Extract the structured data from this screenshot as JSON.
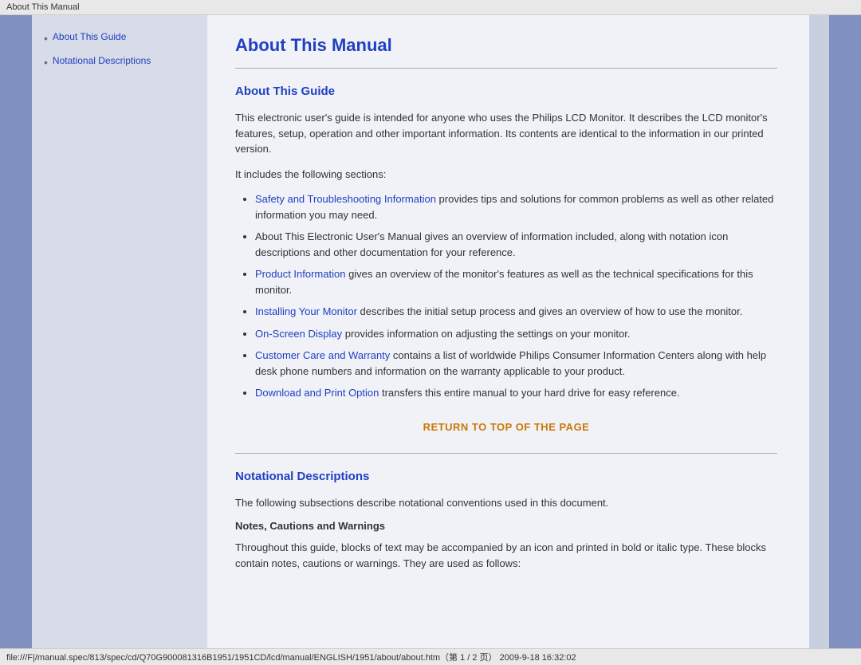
{
  "titleBar": {
    "text": "About This Manual"
  },
  "sidebar": {
    "items": [
      {
        "label": "About This Guide",
        "href": "#about-guide"
      },
      {
        "label": "Notational Descriptions",
        "href": "#notational"
      }
    ]
  },
  "content": {
    "pageTitle": "About This Manual",
    "sections": [
      {
        "id": "about-guide",
        "title": "About This Guide",
        "intro": "This electronic user's guide is intended for anyone who uses the Philips LCD Monitor. It describes the LCD monitor's features, setup, operation and other important information. Its contents are identical to the information in our printed version.",
        "includesText": "It includes the following sections:",
        "bulletItems": [
          {
            "linkText": "Safety and Troubleshooting Information",
            "restText": " provides tips and solutions for common problems as well as other related information you may need."
          },
          {
            "linkText": "",
            "restText": "About This Electronic User's Manual gives an overview of information included, along with notation icon descriptions and other documentation for your reference."
          },
          {
            "linkText": "Product Information",
            "restText": " gives an overview of the monitor's features as well as the technical specifications for this monitor."
          },
          {
            "linkText": "Installing Your Monitor",
            "restText": " describes the initial setup process and gives an overview of how to use the monitor."
          },
          {
            "linkText": "On-Screen Display",
            "restText": " provides information on adjusting the settings on your monitor."
          },
          {
            "linkText": "Customer Care and Warranty",
            "restText": " contains a list of worldwide Philips Consumer Information Centers along with help desk phone numbers and information on the warranty applicable to your product."
          },
          {
            "linkText": "Download and Print Option",
            "restText": " transfers this entire manual to your hard drive for easy reference."
          }
        ]
      },
      {
        "id": "notational",
        "title": "Notational Descriptions",
        "intro": "The following subsections describe notational conventions used in this document.",
        "notesTitle": "Notes, Cautions and Warnings",
        "notesBody": "Throughout this guide, blocks of text may be accompanied by an icon and printed in bold or italic type. These blocks contain notes, cautions or warnings. They are used as follows:"
      }
    ],
    "returnToTop": "RETURN TO TOP OF THE PAGE"
  },
  "statusBar": {
    "text": "file:///F|/manual.spec/813/spec/cd/Q70G900081316B1951/1951CD/lcd/manual/ENGLISH/1951/about/about.htm（第 1 / 2 页） 2009-9-18 16:32:02"
  }
}
